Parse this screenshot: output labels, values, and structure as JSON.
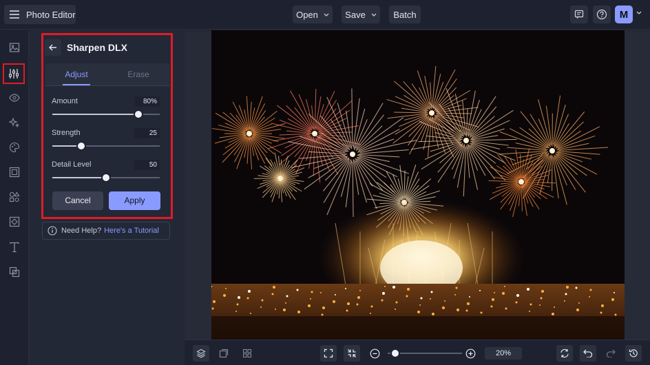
{
  "app": {
    "title": "Photo Editor"
  },
  "toolbar": {
    "open_label": "Open",
    "save_label": "Save",
    "batch_label": "Batch"
  },
  "user": {
    "initial": "M"
  },
  "panel": {
    "title": "Sharpen DLX",
    "tabs": [
      {
        "label": "Adjust",
        "active": true
      },
      {
        "label": "Erase",
        "active": false
      }
    ],
    "controls": [
      {
        "label": "Amount",
        "value": "80%",
        "level": 0.8
      },
      {
        "label": "Strength",
        "value": "25",
        "level": 0.27
      },
      {
        "label": "Detail Level",
        "value": "50",
        "level": 0.5
      }
    ],
    "cancel_label": "Cancel",
    "apply_label": "Apply"
  },
  "help": {
    "text": "Need Help?",
    "link": "Here's a Tutorial"
  },
  "zoom": {
    "value": "20%",
    "level": 0.05
  },
  "colors": {
    "accent": "#8a9bff",
    "highlight": "#e01c24",
    "background": "#1e2230",
    "panel": "#232837"
  },
  "icons": {
    "rail": [
      "image-icon",
      "sliders-icon",
      "eye-icon",
      "sparkle-icon",
      "palette-icon",
      "frame-icon",
      "shapes-icon",
      "texture-icon",
      "text-icon",
      "overlay-icon"
    ],
    "bottom": [
      "layers-icon",
      "compare-icon",
      "grid-icon",
      "fit-screen-icon",
      "actual-size-icon",
      "zoom-out-icon",
      "zoom-in-icon",
      "reset-icon",
      "undo-icon",
      "redo-icon",
      "history-icon"
    ]
  }
}
